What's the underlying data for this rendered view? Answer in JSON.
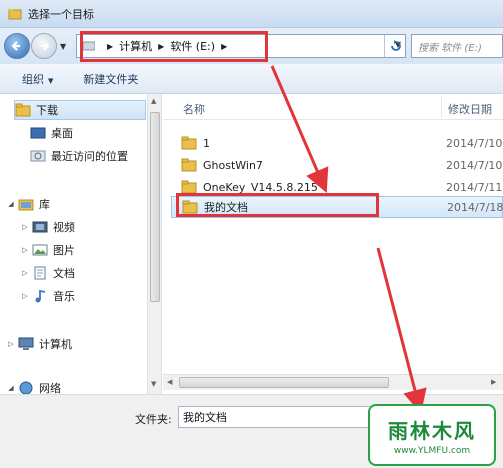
{
  "window": {
    "title": "选择一个目标"
  },
  "address": {
    "crumbs": [
      "计算机",
      "软件 (E:)"
    ],
    "search_placeholder": "搜索 软件 (E:)"
  },
  "toolbar": {
    "organize_label": "组织",
    "new_folder_label": "新建文件夹"
  },
  "nav": {
    "favorites": [
      "下载",
      "桌面",
      "最近访问的位置"
    ],
    "library_label": "库",
    "libraries": [
      "视频",
      "图片",
      "文档",
      "音乐"
    ],
    "computer_label": "计算机",
    "network_label": "网络"
  },
  "files": {
    "columns": {
      "name": "名称",
      "date": "修改日期"
    },
    "rows": [
      {
        "name": "1",
        "date": "2014/7/10"
      },
      {
        "name": "GhostWin7",
        "date": "2014/7/10"
      },
      {
        "name": "OneKey_V14.5.8.215",
        "date": "2014/7/11"
      },
      {
        "name": "我的文档",
        "date": "2014/7/18"
      }
    ]
  },
  "bottom": {
    "folder_label": "文件夹:",
    "folder_value": "我的文档"
  },
  "watermark": {
    "text": "雨林木风",
    "url": "www.YLMFU.com"
  },
  "colors": {
    "annotation": "#e2353a",
    "folder": "#e8c04a"
  },
  "icons": {
    "back": "back-arrow-icon",
    "forward": "forward-arrow-icon",
    "refresh": "refresh-icon",
    "search": "search-icon",
    "folder": "folder-icon"
  }
}
